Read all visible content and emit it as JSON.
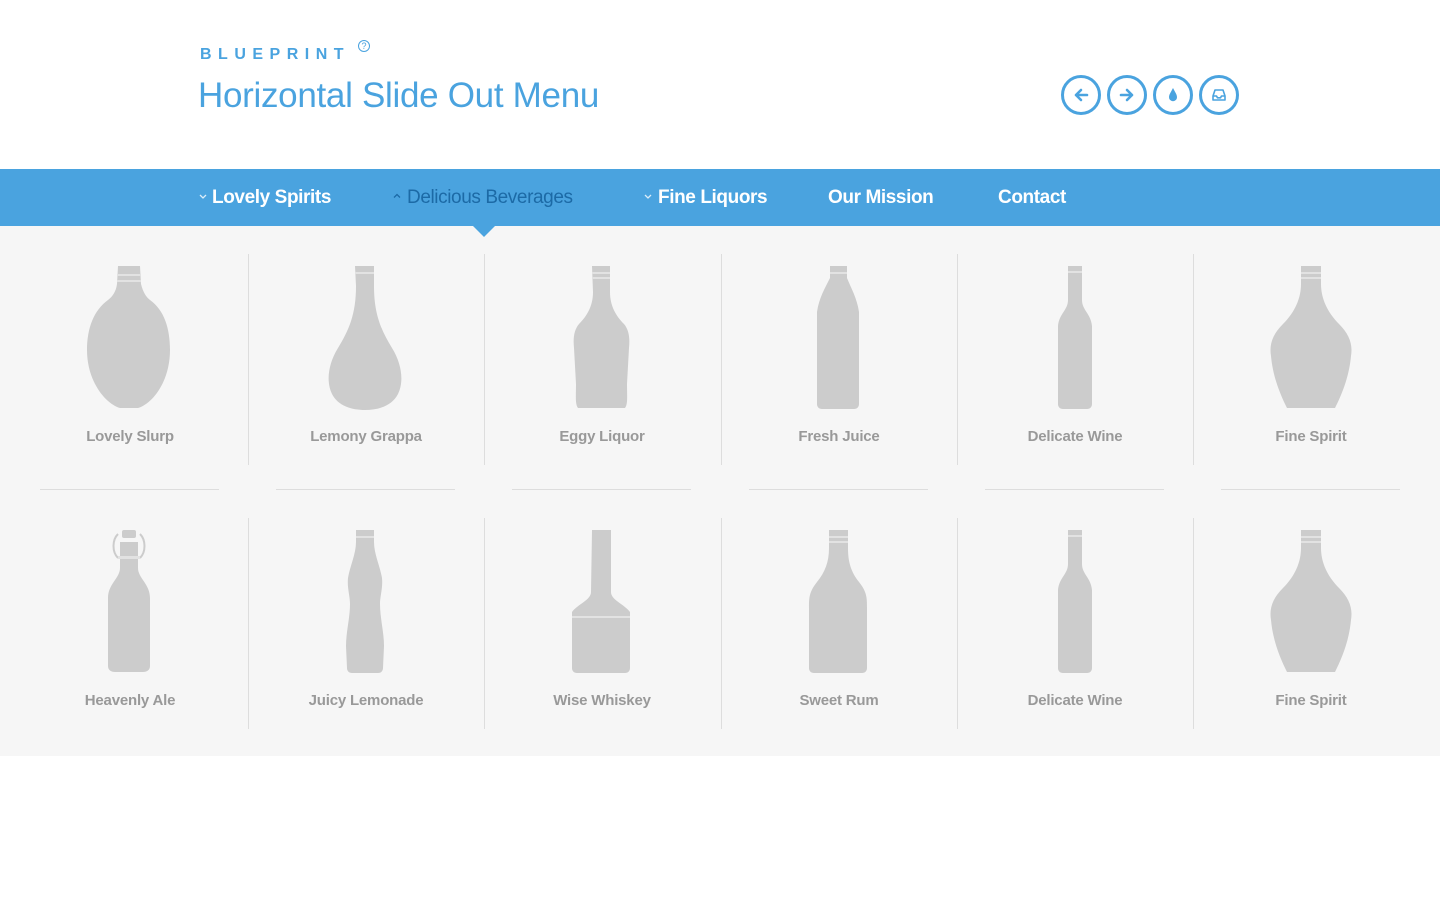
{
  "header": {
    "brand": "BLUEPRINT",
    "brand_sup": "?",
    "title": "Horizontal Slide Out Menu",
    "icons": [
      "arrow-left-icon",
      "arrow-right-icon",
      "drop-icon",
      "inbox-icon"
    ]
  },
  "nav": {
    "items": [
      {
        "label": "Lovely Spirits",
        "has_chevron": true,
        "chevron": "down",
        "active": false
      },
      {
        "label": "Delicious Beverages",
        "has_chevron": true,
        "chevron": "up",
        "active": true
      },
      {
        "label": "Fine Liquors",
        "has_chevron": true,
        "chevron": "down",
        "active": false
      },
      {
        "label": "Our Mission",
        "has_chevron": false,
        "active": false
      },
      {
        "label": "Contact",
        "has_chevron": false,
        "active": false
      }
    ]
  },
  "products": {
    "row1": [
      {
        "label": "Lovely Slurp",
        "icon": "round-bottle-icon"
      },
      {
        "label": "Lemony Grappa",
        "icon": "teardrop-bottle-icon"
      },
      {
        "label": "Eggy Liquor",
        "icon": "liqueur-bottle-icon"
      },
      {
        "label": "Fresh Juice",
        "icon": "juice-bottle-icon"
      },
      {
        "label": "Delicate Wine",
        "icon": "wine-bottle-icon"
      },
      {
        "label": "Fine Spirit",
        "icon": "decanter-bottle-icon"
      }
    ],
    "row2": [
      {
        "label": "Heavenly Ale",
        "icon": "swing-top-bottle-icon"
      },
      {
        "label": "Juicy Lemonade",
        "icon": "soda-bottle-icon"
      },
      {
        "label": "Wise Whiskey",
        "icon": "whiskey-bottle-icon"
      },
      {
        "label": "Sweet Rum",
        "icon": "rum-bottle-icon"
      },
      {
        "label": "Delicate Wine",
        "icon": "wine-bottle-icon"
      },
      {
        "label": "Fine Spirit",
        "icon": "decanter-bottle-icon"
      }
    ]
  },
  "colors": {
    "accent": "#4aa3df",
    "nav_active": "#1c6aa6",
    "panel_bg": "#f6f6f6",
    "bottle": "#cccccc",
    "label": "#999999"
  }
}
